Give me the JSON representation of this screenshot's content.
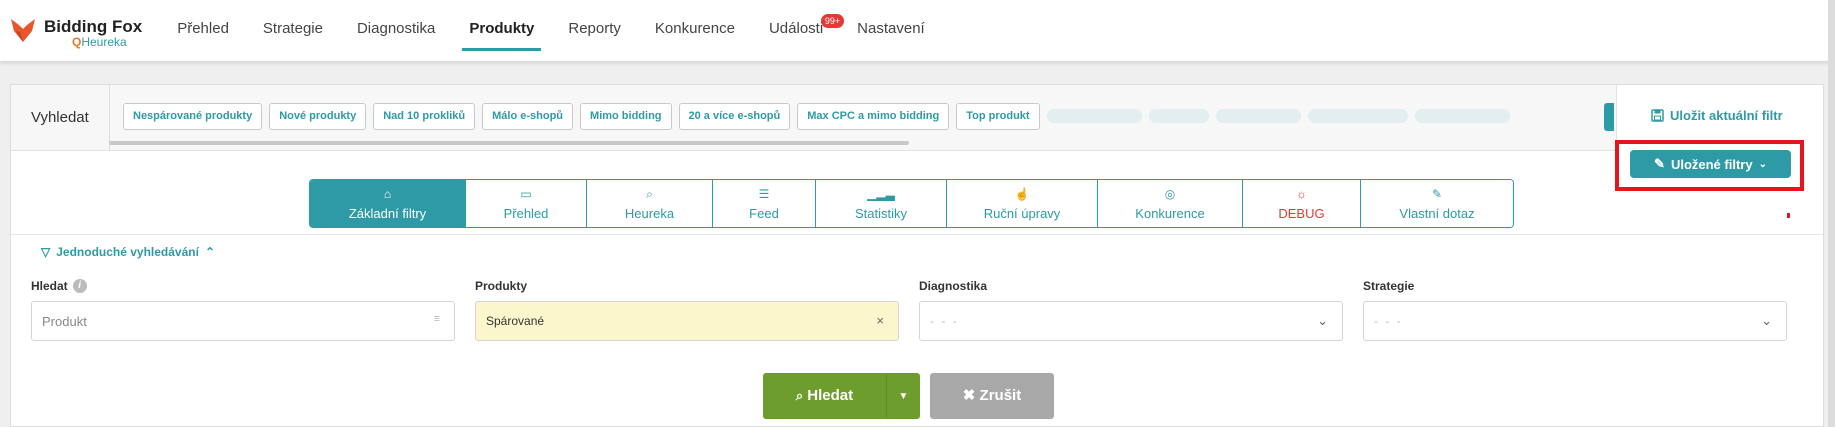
{
  "brand": {
    "name": "Bidding Fox",
    "sub": "Heureka",
    "accent": "#2e9aa6",
    "orange": "#e87722"
  },
  "nav": {
    "items": [
      "Přehled",
      "Strategie",
      "Diagnostika",
      "Produkty",
      "Reporty",
      "Konkurence",
      "Události",
      "Nastavení"
    ],
    "active": "Produkty",
    "events_badge": "99+"
  },
  "search": {
    "label": "Vyhledat",
    "chips": [
      "Nespárované produkty",
      "Nové produkty",
      "Nad 10 prokliků",
      "Málo e-shopů",
      "Mimo bidding",
      "20 a více e-shopů",
      "Max CPC a mimo bidding",
      "Top produkt"
    ],
    "save_current": "Uložit aktuální filtr",
    "saved_filters": "Uložené filtry"
  },
  "tabs": [
    {
      "label": "Základní filtry",
      "icon": "home-icon",
      "active": true
    },
    {
      "label": "Přehled",
      "icon": "inbox-icon"
    },
    {
      "label": "Heureka",
      "icon": "search-check-icon"
    },
    {
      "label": "Feed",
      "icon": "list-icon"
    },
    {
      "label": "Statistiky",
      "icon": "bars-icon"
    },
    {
      "label": "Ruční úpravy",
      "icon": "hand-icon"
    },
    {
      "label": "Konkurence",
      "icon": "users-icon"
    },
    {
      "label": "DEBUG",
      "icon": "bug-icon"
    },
    {
      "label": "Vlastní dotaz",
      "icon": "pencil-icon"
    }
  ],
  "simple_search": "Jednoduché vyhledávání",
  "fields": {
    "hledat": {
      "label": "Hledat",
      "placeholder": "Produkt"
    },
    "produkty": {
      "label": "Produkty",
      "value": "Spárované"
    },
    "diagnostika": {
      "label": "Diagnostika",
      "value": "- - -"
    },
    "strategie": {
      "label": "Strategie",
      "value": "- - -"
    }
  },
  "actions": {
    "search": "Hledat",
    "cancel": "Zrušit"
  }
}
